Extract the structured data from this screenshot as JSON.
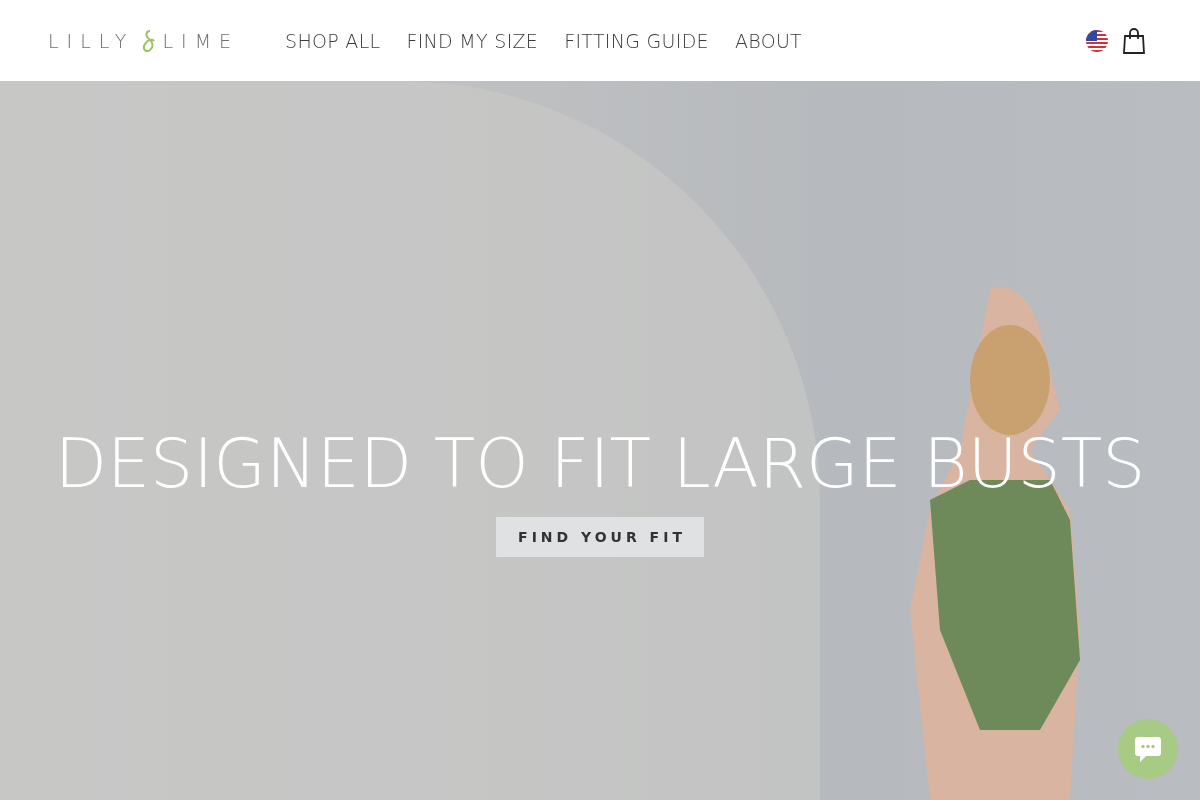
{
  "header": {
    "logo": {
      "left": "LILLY",
      "right": "LIME"
    },
    "nav": [
      {
        "label": "SHOP ALL"
      },
      {
        "label": "FIND MY SIZE"
      },
      {
        "label": "FITTING GUIDE"
      },
      {
        "label": "ABOUT"
      }
    ]
  },
  "hero": {
    "heading": "DESIGNED TO FIT LARGE BUSTS",
    "button": "FIND YOUR FIT"
  }
}
